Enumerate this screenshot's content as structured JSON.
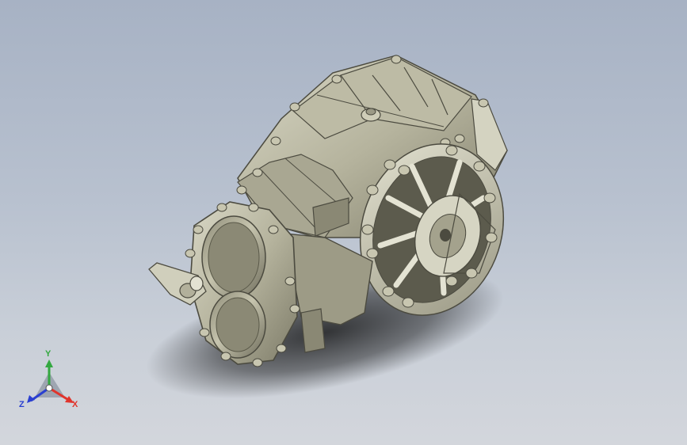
{
  "viewport": {
    "background_top": "#a7b2c4",
    "background_bottom": "#d3d6dc",
    "model_color": "#c9c7b1",
    "model_shadow": "#7f7d6b",
    "model_dark": "#4c4b40"
  },
  "triad": {
    "x_label": "X",
    "y_label": "Y",
    "z_label": "Z",
    "x_color": "#e0342c",
    "y_color": "#33a840",
    "z_color": "#2a3fd0"
  },
  "icons": {
    "model": "transfer-case-gearbox-3d-model",
    "triad": "coordinate-triad-icon"
  }
}
